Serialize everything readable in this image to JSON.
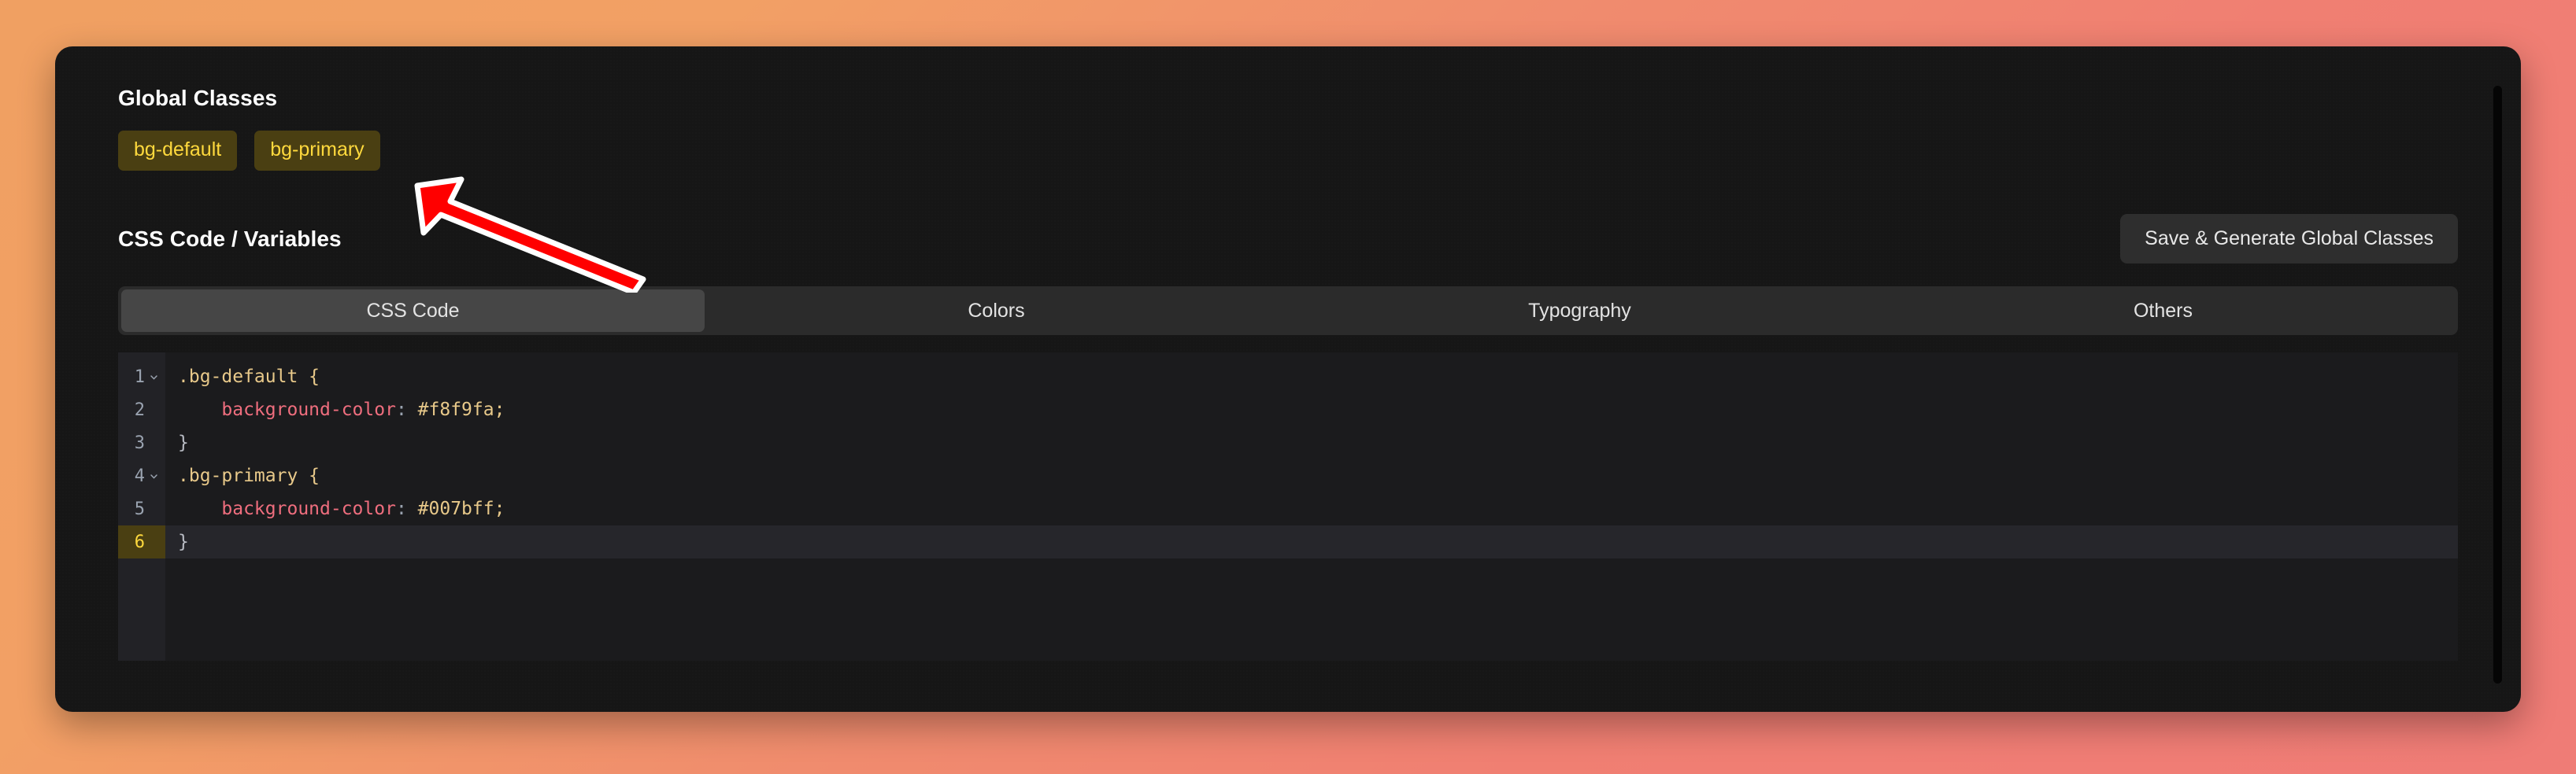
{
  "panel": {
    "global_classes": {
      "heading": "Global Classes",
      "chips": [
        {
          "label": "bg-default"
        },
        {
          "label": "bg-primary"
        }
      ]
    },
    "css_variables": {
      "heading": "CSS Code / Variables",
      "save_button_label": "Save & Generate Global Classes",
      "tabs": [
        {
          "label": "CSS Code",
          "active": true
        },
        {
          "label": "Colors",
          "active": false
        },
        {
          "label": "Typography",
          "active": false
        },
        {
          "label": "Others",
          "active": false
        }
      ],
      "editor": {
        "gutter": [
          {
            "number": "1",
            "foldable": true,
            "active": false
          },
          {
            "number": "2",
            "foldable": false,
            "active": false
          },
          {
            "number": "3",
            "foldable": false,
            "active": false
          },
          {
            "number": "4",
            "foldable": true,
            "active": false
          },
          {
            "number": "5",
            "foldable": false,
            "active": false
          },
          {
            "number": "6",
            "foldable": false,
            "active": true
          }
        ],
        "lines": [
          {
            "selector": ".bg-default",
            "brace": " {"
          },
          {
            "prop": "background-color",
            "colon": ": ",
            "value": "#f8f9fa;"
          },
          {
            "close": "}"
          },
          {
            "selector": ".bg-primary",
            "brace": " {"
          },
          {
            "prop": "background-color",
            "colon": ": ",
            "value": "#007bff;"
          },
          {
            "close": "}"
          }
        ],
        "line_1_text": ".bg-default {",
        "line_2_prop": "background-color",
        "line_2_colon": ": ",
        "line_2_value": "#f8f9fa;",
        "line_3_text": "}",
        "line_4_text": ".bg-primary {",
        "line_5_prop": "background-color",
        "line_5_colon": ": ",
        "line_5_value": "#007bff;",
        "line_6_text": "}"
      }
    }
  },
  "annotation": {
    "arrow": {
      "name": "red-pointer-arrow",
      "points_to": "bg-primary",
      "fill_color": "#ff0000",
      "outline_color": "#ffffff"
    }
  },
  "theme": {
    "page_gradient_start": "#f0a062",
    "page_gradient_end": "#ef7c76",
    "panel_background": "#161616",
    "chip_background": "#4a3f12",
    "chip_text": "#ffd93d",
    "tab_active_background": "#464646",
    "tab_bar_background": "#2b2b2b",
    "editor_background": "#1b1b1d",
    "editor_gutter_background": "#222226",
    "token_selector": "#e8c98a",
    "token_property": "#ef6e7e",
    "token_value": "#e8c98a"
  }
}
